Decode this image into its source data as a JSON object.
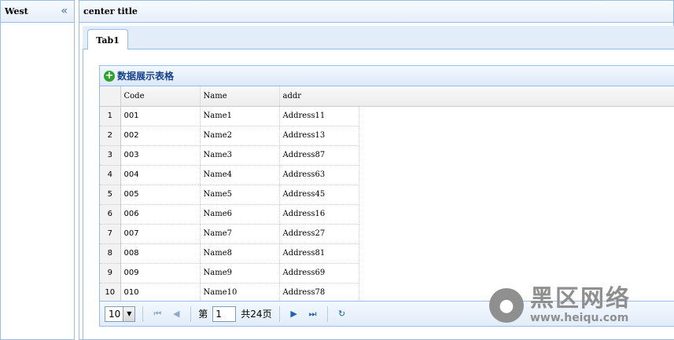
{
  "west": {
    "title": "West",
    "collapse_glyph": "«"
  },
  "center": {
    "title": "center title"
  },
  "tabs": [
    {
      "label": "Tab1"
    }
  ],
  "grid": {
    "title": "数据展示表格",
    "icon": "add-icon",
    "columns": [
      "Code",
      "Name",
      "addr"
    ],
    "rows": [
      {
        "rownum": "1",
        "code": "001",
        "name": "Name1",
        "addr": "Address11"
      },
      {
        "rownum": "2",
        "code": "002",
        "name": "Name2",
        "addr": "Address13"
      },
      {
        "rownum": "3",
        "code": "003",
        "name": "Name3",
        "addr": "Address87"
      },
      {
        "rownum": "4",
        "code": "004",
        "name": "Name4",
        "addr": "Address63"
      },
      {
        "rownum": "5",
        "code": "005",
        "name": "Name5",
        "addr": "Address45"
      },
      {
        "rownum": "6",
        "code": "006",
        "name": "Name6",
        "addr": "Address16"
      },
      {
        "rownum": "7",
        "code": "007",
        "name": "Name7",
        "addr": "Address27"
      },
      {
        "rownum": "8",
        "code": "008",
        "name": "Name8",
        "addr": "Address81"
      },
      {
        "rownum": "9",
        "code": "009",
        "name": "Name9",
        "addr": "Address69"
      },
      {
        "rownum": "10",
        "code": "010",
        "name": "Name10",
        "addr": "Address78"
      }
    ]
  },
  "pager": {
    "page_size": "10",
    "page_prefix": "第",
    "current_page": "1",
    "total_label": "共24页"
  },
  "watermark": {
    "main": "黑区网络",
    "url": "www.heiqu.com"
  }
}
